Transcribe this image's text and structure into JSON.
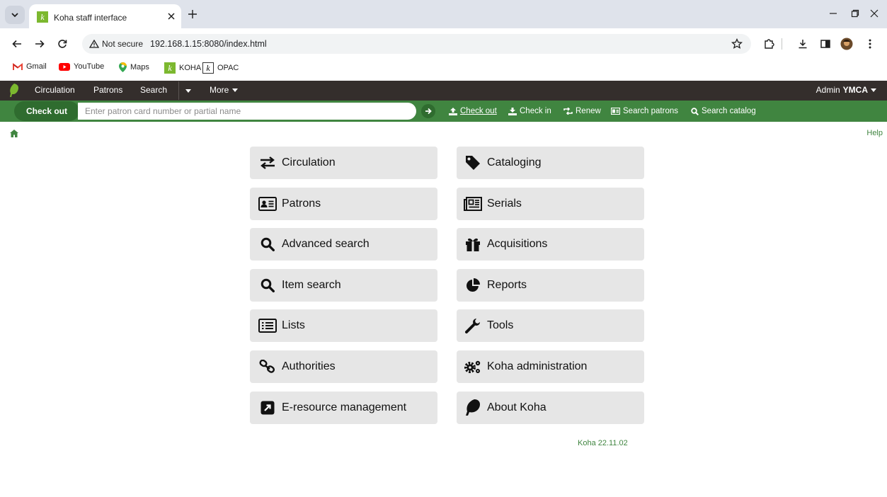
{
  "browser": {
    "tab_title": "Koha staff interface",
    "security_label": "Not secure",
    "url": "192.168.1.15:8080/index.html",
    "bookmarks": [
      {
        "label": "Gmail",
        "icon": "gmail-icon"
      },
      {
        "label": "YouTube",
        "icon": "youtube-icon"
      },
      {
        "label": "Maps",
        "icon": "maps-icon"
      },
      {
        "label": "KOHA",
        "icon": "koha-icon"
      },
      {
        "label": "OPAC",
        "icon": "opac-icon"
      }
    ]
  },
  "koha_nav": {
    "items": [
      "Circulation",
      "Patrons",
      "Search",
      "More"
    ],
    "user_name": "Admin",
    "library": "YMCA"
  },
  "search_bar": {
    "active_label": "Check out",
    "placeholder": "Enter patron card number or partial name",
    "tabs": [
      "Check out",
      "Check in",
      "Renew",
      "Search patrons",
      "Search catalog"
    ]
  },
  "help_label": "Help",
  "modules_left": [
    {
      "label": "Circulation",
      "icon": "arrows-exchange-icon"
    },
    {
      "label": "Patrons",
      "icon": "id-card-icon"
    },
    {
      "label": "Advanced search",
      "icon": "search-icon"
    },
    {
      "label": "Item search",
      "icon": "search-icon"
    },
    {
      "label": "Lists",
      "icon": "list-icon"
    },
    {
      "label": "Authorities",
      "icon": "link-icon"
    },
    {
      "label": "E-resource management",
      "icon": "external-link-icon"
    }
  ],
  "modules_right": [
    {
      "label": "Cataloging",
      "icon": "tag-icon"
    },
    {
      "label": "Serials",
      "icon": "newspaper-icon"
    },
    {
      "label": "Acquisitions",
      "icon": "gift-icon"
    },
    {
      "label": "Reports",
      "icon": "pie-chart-icon"
    },
    {
      "label": "Tools",
      "icon": "wrench-icon"
    },
    {
      "label": "Koha administration",
      "icon": "cogs-icon"
    },
    {
      "label": "About Koha",
      "icon": "koha-leaf-icon"
    }
  ],
  "version": "Koha 22.11.02",
  "colors": {
    "koha_green": "#408540",
    "koha_dark": "#342e2c",
    "button_bg": "#e6e6e6"
  }
}
